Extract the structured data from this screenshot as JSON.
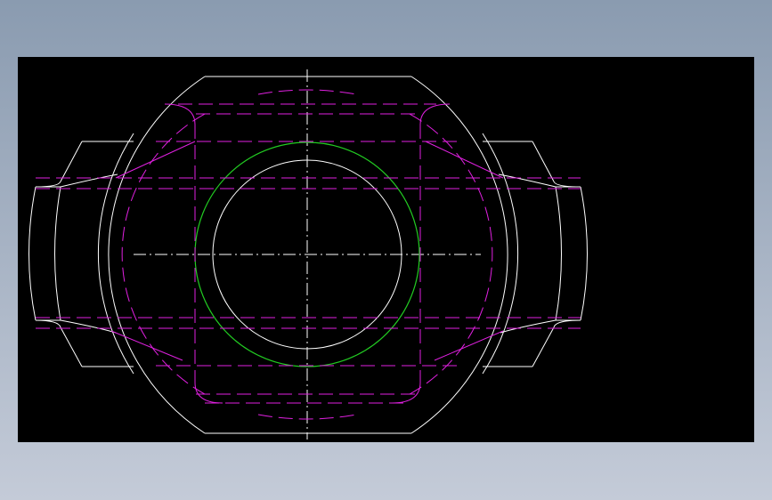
{
  "drawing": {
    "background_color": "#000000",
    "colors": {
      "outline": "#ffffff",
      "hidden_lines": "#e020e0",
      "bore_circle": "#22cc22",
      "centerlines": "#ffffff"
    },
    "linetypes": {
      "outline": "continuous",
      "hidden_lines": "dashed",
      "centerlines": "dash-dot"
    }
  }
}
